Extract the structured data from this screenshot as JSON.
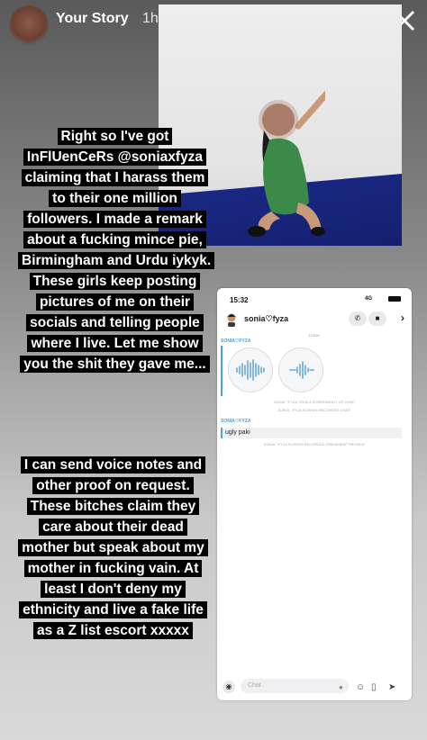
{
  "story": {
    "title": "Your Story",
    "time": "1h"
  },
  "caption_top": "Right so I've got InFlUenCeRs @soniaxfyza claiming that I harass them to their one million followers. I made a remark about a fucking mince pie, Birmingham and Urdu iykyk. These girls keep posting pictures of me on their socials and telling people where I live. Let me show you the shit they gave me...",
  "caption_bottom": "I can send voice notes and other proof on request. These bitches claim they care about their dead mother but speak about my mother in fucking vain. At least I don't deny my ethnicity and live a fake life as a Z list escort xxxxx",
  "screenshot": {
    "time": "15:32",
    "network": "4G",
    "contact_name": "sonia♡fyza",
    "day_label": "TODAY",
    "sender_label": "SONIA♡FYZA",
    "notice_screenshot": "SONIA♡FYZA TOOK A SCREENSHOT OF CHAT!",
    "notice_recorded": "SONIA♡FYZA SCREEN RECORDED CHAT!",
    "message_text": "ugly paki",
    "notice_profile": "SONIA♡FYZA SCREEN RECORDED FRIENDSHIP PROFILE!",
    "chat_placeholder": "Chat"
  },
  "colors": {
    "snap_blue": "#4aa0d8",
    "floor_blue": "#1a2a8a",
    "dress_green": "#3c8a4a"
  },
  "icons": [
    "close-icon",
    "share-icon",
    "phone-icon",
    "video-icon",
    "chevron-right-icon",
    "camera-icon",
    "mic-icon",
    "emoji-icon",
    "sticker-icon",
    "rocket-icon"
  ]
}
